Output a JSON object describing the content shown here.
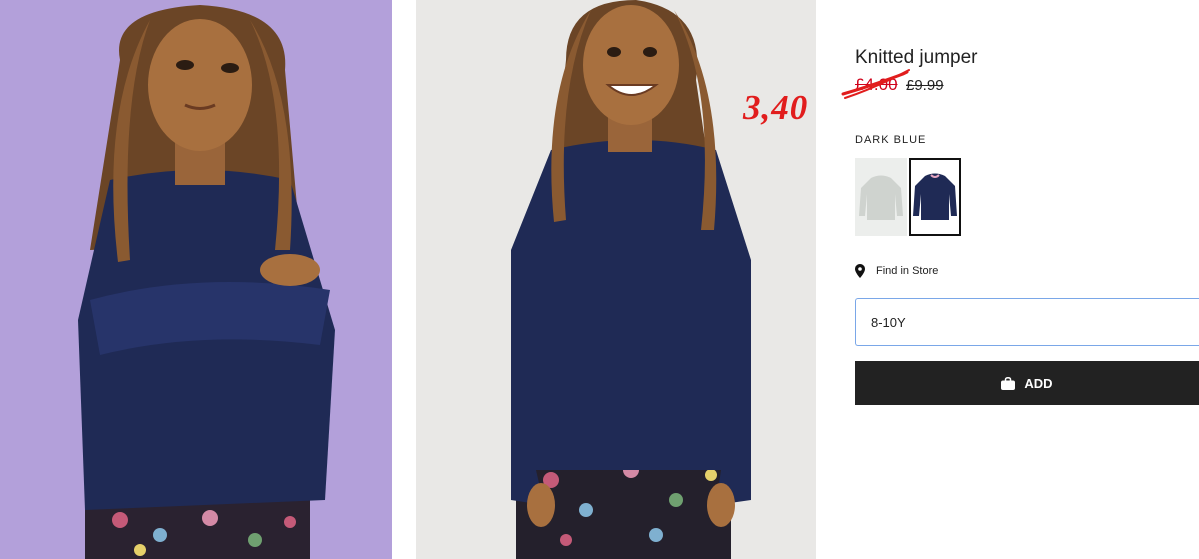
{
  "product": {
    "title": "Knitted jumper",
    "sale_price": "£4.00",
    "original_price": "£9.99",
    "handwritten_price": "3,40",
    "color_label": "DARK BLUE",
    "swatches": [
      {
        "name": "light grey",
        "color": "#e6e8e5"
      },
      {
        "name": "dark blue",
        "color": "#1f2a55",
        "selected": true
      }
    ]
  },
  "store": {
    "label": "Find in Store",
    "icon": "map-pin-icon"
  },
  "size": {
    "value": "8-10Y"
  },
  "add_button": {
    "label": "ADD",
    "icon": "shopping-bag-icon"
  },
  "colors": {
    "sale_red": "#d0021b",
    "annotation_red": "#e11d1d",
    "button_bg": "#222222",
    "focus_border": "#7aa7e8",
    "photo1_bg": "#b3a0da",
    "photo2_bg": "#e9e8e6",
    "sweater": "#1f2a55"
  }
}
